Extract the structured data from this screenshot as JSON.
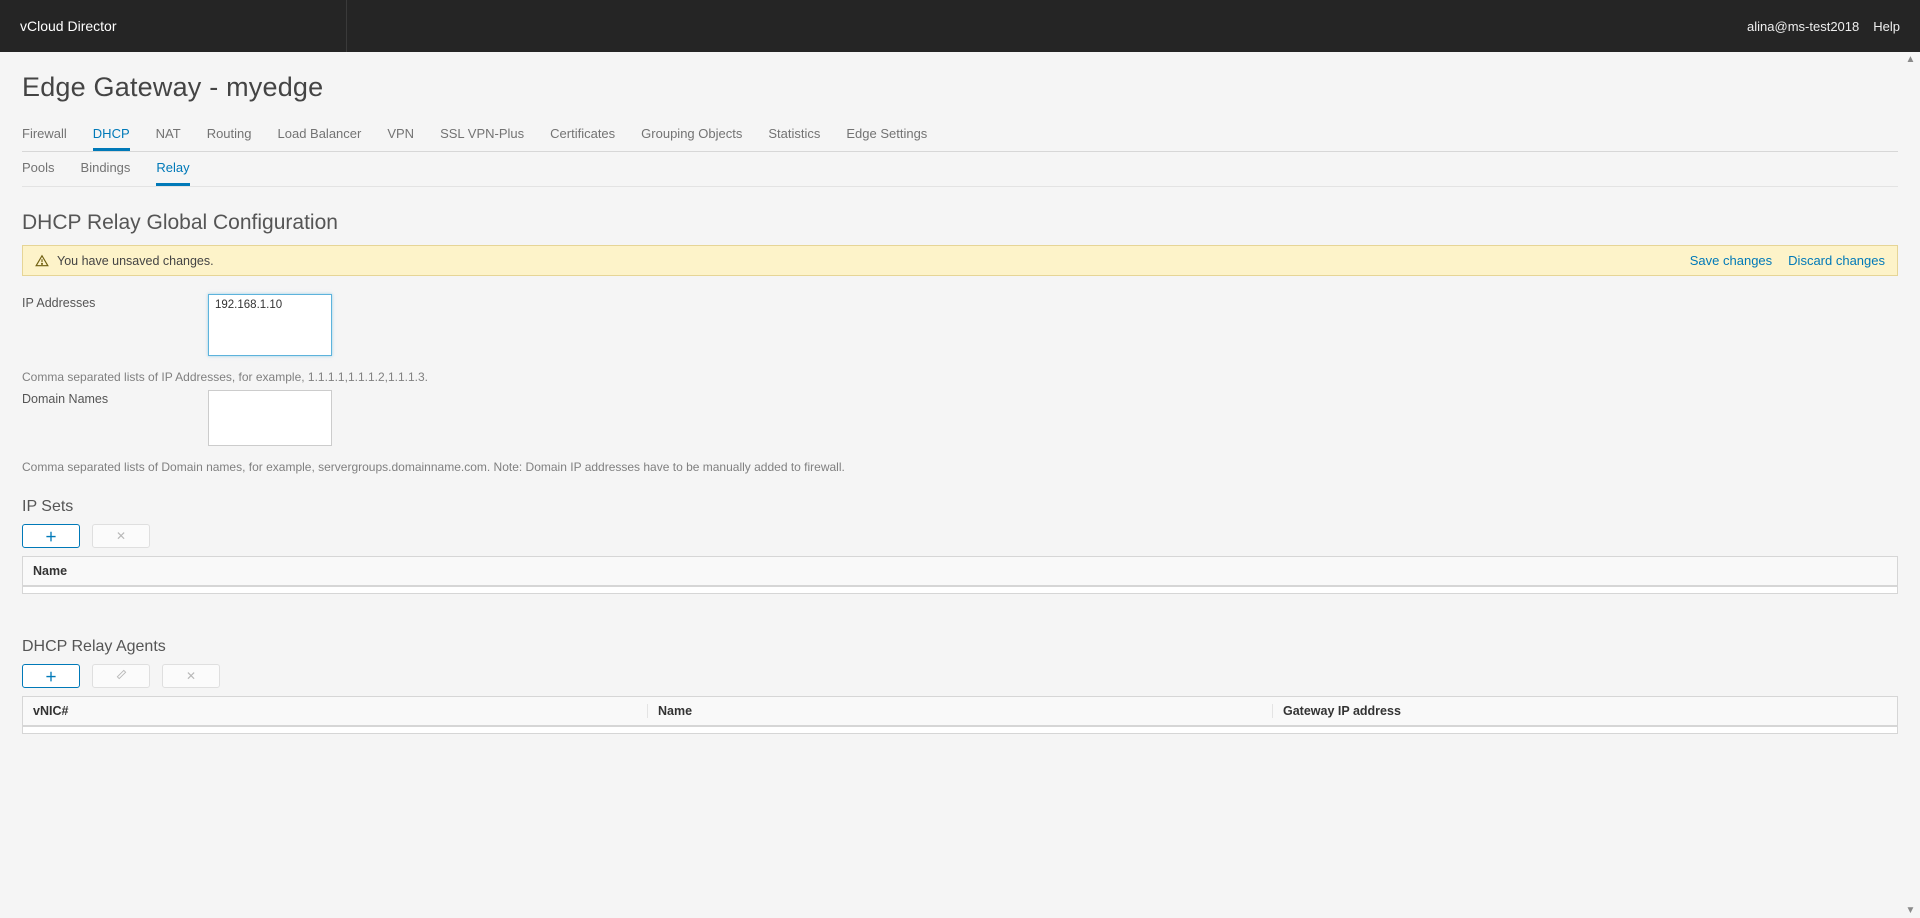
{
  "brand": "vCloud Director",
  "header": {
    "user_label": "alina@ms-test2018",
    "help_label": "Help"
  },
  "page_title": "Edge Gateway - myedge",
  "tabs_primary": [
    {
      "label": "Firewall"
    },
    {
      "label": "DHCP",
      "active": true
    },
    {
      "label": "NAT"
    },
    {
      "label": "Routing"
    },
    {
      "label": "Load Balancer"
    },
    {
      "label": "VPN"
    },
    {
      "label": "SSL VPN-Plus"
    },
    {
      "label": "Certificates"
    },
    {
      "label": "Grouping Objects"
    },
    {
      "label": "Statistics"
    },
    {
      "label": "Edge Settings"
    }
  ],
  "tabs_secondary": [
    {
      "label": "Pools"
    },
    {
      "label": "Bindings"
    },
    {
      "label": "Relay",
      "active": true
    }
  ],
  "section_title": "DHCP Relay Global Configuration",
  "alert": {
    "message": "You have unsaved changes.",
    "save_label": "Save changes",
    "discard_label": "Discard changes"
  },
  "form": {
    "ip_addresses_label": "IP Addresses",
    "ip_addresses_value": "192.168.1.10",
    "ip_addresses_helper": "Comma separated lists of IP Addresses, for example, 1.1.1.1,1.1.1.2,1.1.1.3.",
    "domain_names_label": "Domain Names",
    "domain_names_value": "",
    "domain_names_helper": "Comma separated lists of Domain names, for example, servergroups.domainname.com. Note: Domain IP addresses have to be manually added to firewall."
  },
  "ipsets": {
    "title": "IP Sets",
    "columns": [
      "Name"
    ]
  },
  "relay_agents": {
    "title": "DHCP Relay Agents",
    "columns": [
      "vNIC#",
      "Name",
      "Gateway IP address"
    ]
  }
}
